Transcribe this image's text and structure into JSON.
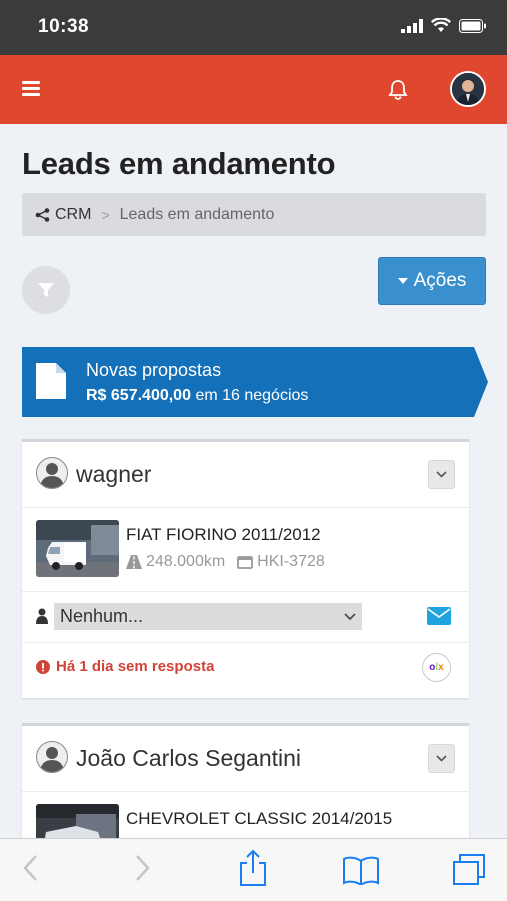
{
  "status_bar": {
    "time": "10:38"
  },
  "header": {
    "menu_icon": "hamburger-icon",
    "notification_icon": "bell-icon",
    "avatar": "user-avatar",
    "color": "#e0472f"
  },
  "page": {
    "title": "Leads em andamento"
  },
  "breadcrumb": {
    "root": "CRM",
    "separator": ">",
    "current": "Leads em andamento"
  },
  "toolbar": {
    "filter_icon": "filter-icon",
    "actions_label": "Ações"
  },
  "banner": {
    "title": "Novas propostas",
    "amount": "R$ 657.400,00",
    "suffix": "em 16 negócios",
    "color": "#1470b8"
  },
  "leads": [
    {
      "name": "wagner",
      "vehicle": "FIAT FIORINO 2011/2012",
      "mileage": "248.000km",
      "plate": "HKI-3728",
      "assignee": "Nenhum...",
      "status": "Há 1 dia sem resposta",
      "source": "olx"
    },
    {
      "name": "João Carlos Segantini",
      "vehicle": "CHEVROLET CLASSIC 2014/2015"
    }
  ],
  "safari": {
    "back": "back-icon",
    "forward": "forward-icon",
    "share": "share-icon",
    "bookmarks": "bookmarks-icon",
    "tabs": "tabs-icon"
  }
}
